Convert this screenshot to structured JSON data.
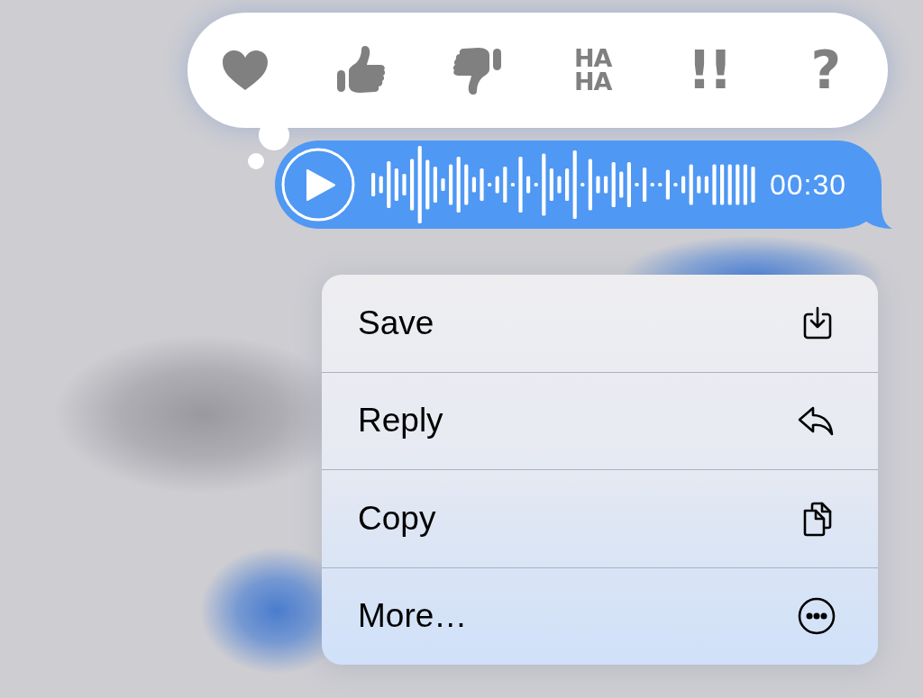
{
  "reaction_bar": {
    "reactions": [
      {
        "kind": "heart",
        "selected": false
      },
      {
        "kind": "thumbs_up",
        "selected": false
      },
      {
        "kind": "thumbs_down",
        "selected": false
      },
      {
        "kind": "text",
        "text": "HA HA",
        "selected": false
      },
      {
        "kind": "text",
        "text": "!!",
        "selected": false
      },
      {
        "kind": "text",
        "text": "?",
        "selected": false
      }
    ]
  },
  "voice_message": {
    "duration": "00:30"
  },
  "context_menu": {
    "items": [
      {
        "kind": "save",
        "label": "Save"
      },
      {
        "kind": "reply",
        "label": "Reply"
      },
      {
        "kind": "copy",
        "label": "Copy"
      },
      {
        "kind": "more",
        "label": "More…"
      }
    ]
  }
}
